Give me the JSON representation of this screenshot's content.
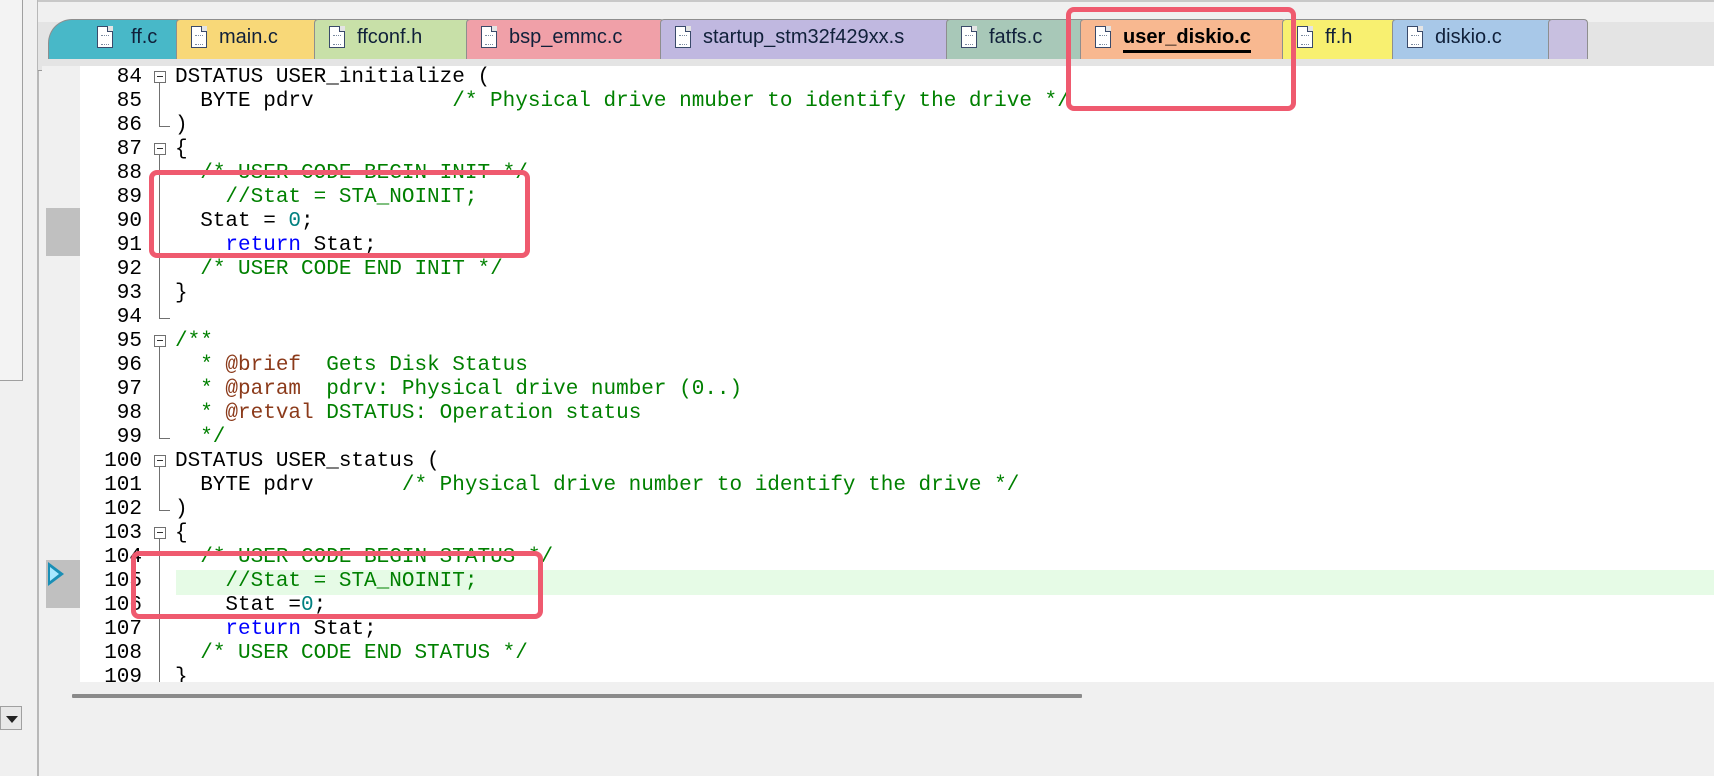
{
  "tabs": [
    {
      "label": "ff.c",
      "color": "#48b8c8"
    },
    {
      "label": "main.c",
      "color": "#f8d878"
    },
    {
      "label": "ffconf.h",
      "color": "#c8e0a8"
    },
    {
      "label": "bsp_emmc.c",
      "color": "#f0a0a8"
    },
    {
      "label": "startup_stm32f429xx.s",
      "color": "#c0b8e0"
    },
    {
      "label": "fatfs.c",
      "color": "#a8c8b8"
    },
    {
      "label": "user_diskio.c",
      "color": "#f8b890",
      "active": true
    },
    {
      "label": "ff.h",
      "color": "#f8f070"
    },
    {
      "label": "diskio.c",
      "color": "#a8c8e8"
    }
  ],
  "editor": {
    "highlighted_line": "105",
    "execution_marker_line": "105",
    "lines": [
      {
        "n": "84",
        "fold": "open",
        "segs": [
          [
            "DSTATUS USER_initialize (",
            ""
          ]
        ]
      },
      {
        "n": "85",
        "fold": "bar",
        "segs": [
          [
            "  BYTE pdrv           ",
            ""
          ],
          [
            "/* Physical drive nmuber to identify the drive */",
            "c-comment"
          ]
        ]
      },
      {
        "n": "86",
        "fold": "end",
        "segs": [
          [
            ")",
            ""
          ]
        ]
      },
      {
        "n": "87",
        "fold": "open",
        "segs": [
          [
            "{",
            ""
          ]
        ]
      },
      {
        "n": "88",
        "fold": "bar",
        "segs": [
          [
            "  ",
            ""
          ],
          [
            "/* USER CODE BEGIN INIT */",
            "c-comment"
          ]
        ]
      },
      {
        "n": "89",
        "fold": "bar",
        "segs": [
          [
            "    ",
            ""
          ],
          [
            "//Stat = STA_NOINIT;",
            "c-comment"
          ]
        ]
      },
      {
        "n": "90",
        "fold": "bar",
        "segs": [
          [
            "  Stat = ",
            ""
          ],
          [
            "0",
            "c-num"
          ],
          [
            ";",
            ""
          ]
        ]
      },
      {
        "n": "91",
        "fold": "bar",
        "segs": [
          [
            "    ",
            ""
          ],
          [
            "return",
            "c-kw"
          ],
          [
            " Stat;",
            ""
          ]
        ]
      },
      {
        "n": "92",
        "fold": "bar",
        "segs": [
          [
            "  ",
            ""
          ],
          [
            "/* USER CODE END INIT */",
            "c-comment"
          ]
        ]
      },
      {
        "n": "93",
        "fold": "bar",
        "segs": [
          [
            "}",
            ""
          ]
        ]
      },
      {
        "n": "94",
        "fold": "end",
        "segs": [
          [
            "",
            ""
          ]
        ]
      },
      {
        "n": "95",
        "fold": "open",
        "segs": [
          [
            "/**",
            "c-doc"
          ]
        ]
      },
      {
        "n": "96",
        "fold": "bar",
        "segs": [
          [
            "  * ",
            "c-doc"
          ],
          [
            "@brief",
            "c-doctag"
          ],
          [
            "  Gets Disk Status",
            "c-doc"
          ]
        ]
      },
      {
        "n": "97",
        "fold": "bar",
        "segs": [
          [
            "  * ",
            "c-doc"
          ],
          [
            "@param",
            "c-doctag"
          ],
          [
            "  pdrv: Physical drive number (0..)",
            "c-doc"
          ]
        ]
      },
      {
        "n": "98",
        "fold": "bar",
        "segs": [
          [
            "  * ",
            "c-doc"
          ],
          [
            "@retval",
            "c-doctag"
          ],
          [
            " DSTATUS: Operation status",
            "c-doc"
          ]
        ]
      },
      {
        "n": "99",
        "fold": "end",
        "segs": [
          [
            "  */",
            "c-doc"
          ]
        ]
      },
      {
        "n": "100",
        "fold": "open",
        "segs": [
          [
            "DSTATUS USER_status (",
            ""
          ]
        ]
      },
      {
        "n": "101",
        "fold": "bar",
        "segs": [
          [
            "  BYTE pdrv       ",
            ""
          ],
          [
            "/* Physical drive number to identify the drive */",
            "c-comment"
          ]
        ]
      },
      {
        "n": "102",
        "fold": "end",
        "segs": [
          [
            ")",
            ""
          ]
        ]
      },
      {
        "n": "103",
        "fold": "open",
        "segs": [
          [
            "{",
            ""
          ]
        ]
      },
      {
        "n": "104",
        "fold": "bar",
        "segs": [
          [
            "  ",
            ""
          ],
          [
            "/* USER CODE BEGIN STATUS */",
            "c-comment"
          ]
        ]
      },
      {
        "n": "105",
        "fold": "bar",
        "segs": [
          [
            "    ",
            ""
          ],
          [
            "//Stat = STA_NOINIT;",
            "c-comment"
          ]
        ]
      },
      {
        "n": "106",
        "fold": "bar",
        "segs": [
          [
            "    Stat =",
            ""
          ],
          [
            "0",
            "c-num"
          ],
          [
            ";",
            ""
          ]
        ]
      },
      {
        "n": "107",
        "fold": "bar",
        "segs": [
          [
            "    ",
            ""
          ],
          [
            "return",
            "c-kw"
          ],
          [
            " Stat;",
            ""
          ]
        ]
      },
      {
        "n": "108",
        "fold": "bar",
        "segs": [
          [
            "  ",
            ""
          ],
          [
            "/* USER CODE END STATUS */",
            "c-comment"
          ]
        ]
      },
      {
        "n": "109",
        "fold": "bar",
        "segs": [
          [
            "}",
            ""
          ]
        ]
      }
    ]
  },
  "colors": {
    "annotation": "#ef5a6f",
    "comment": "#008000",
    "keyword": "#0000ff",
    "number": "#008080",
    "doc_tag": "#8b3a1a",
    "current_line_bg": "#e6fbe6"
  }
}
